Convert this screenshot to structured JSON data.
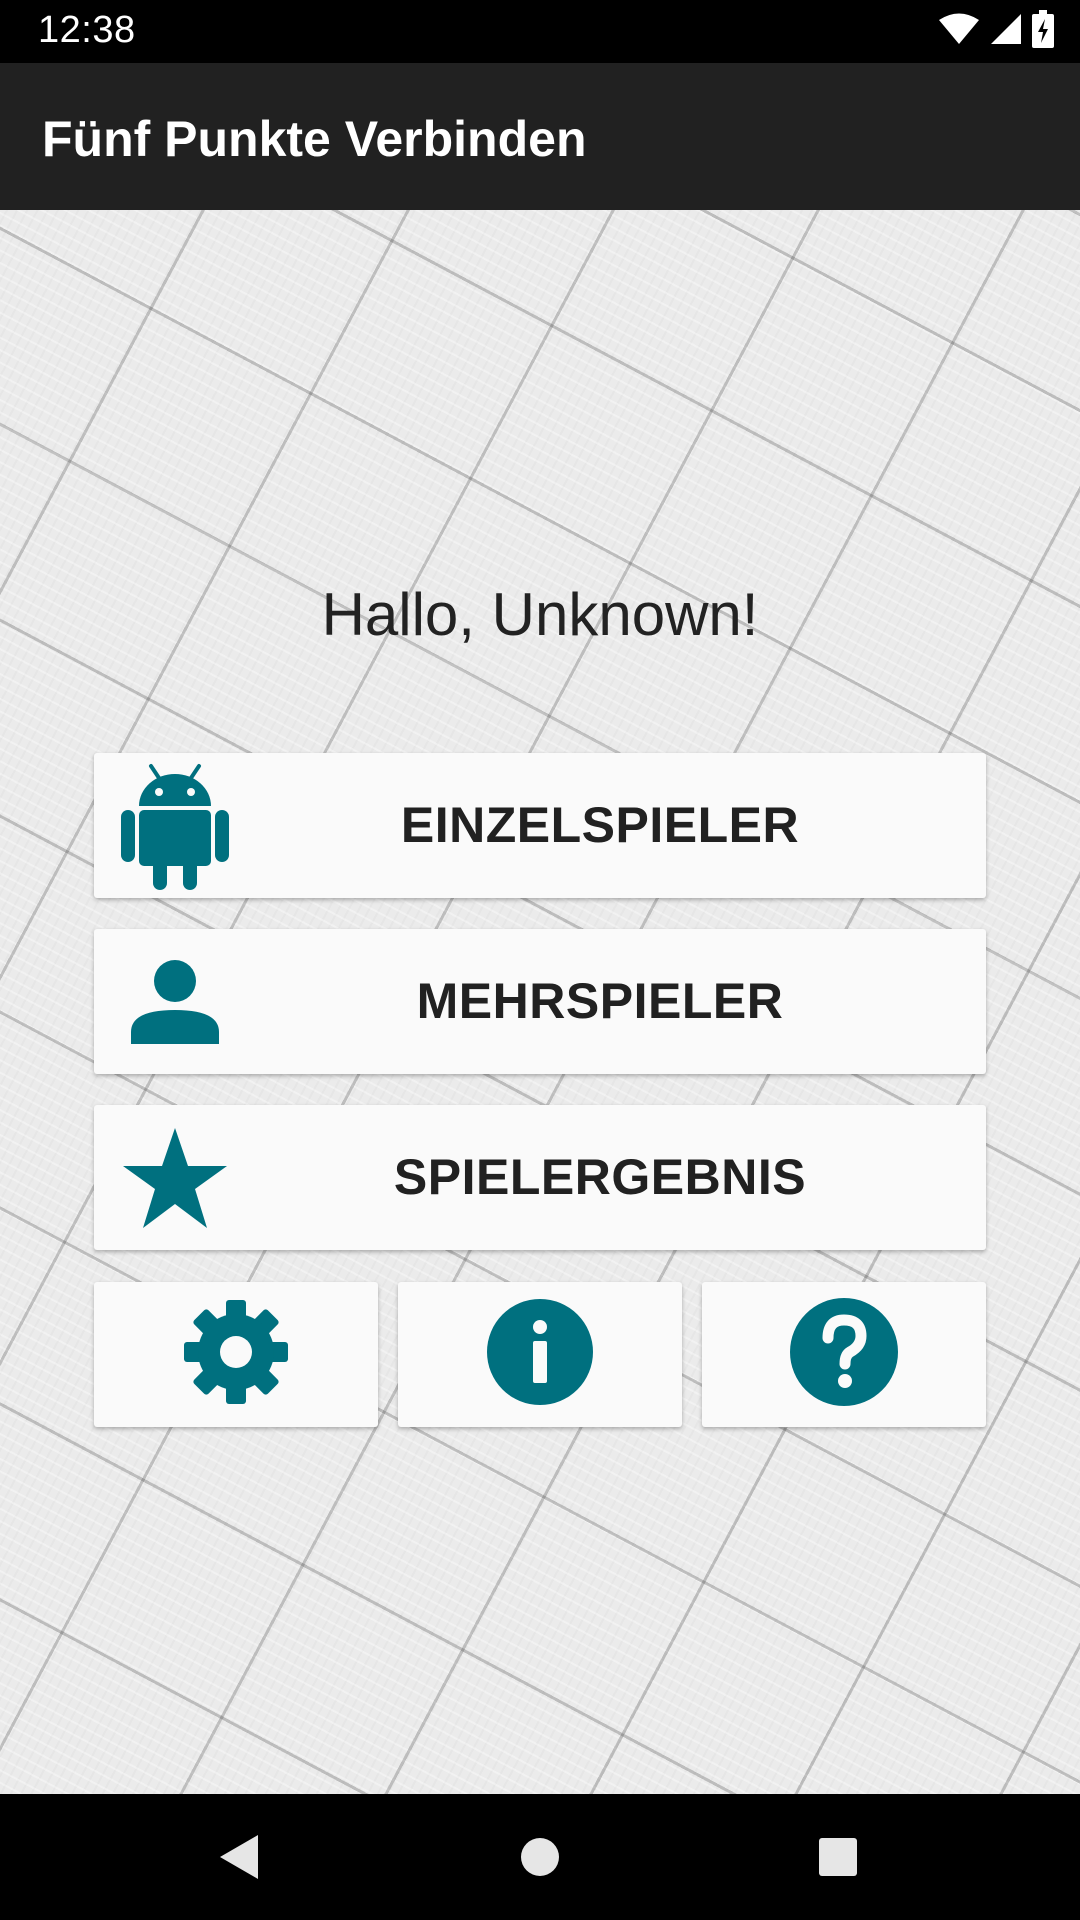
{
  "status_bar": {
    "time": "12:38",
    "icons": [
      "wifi-icon",
      "cell-signal-icon",
      "battery-charging-icon"
    ]
  },
  "app_bar": {
    "title": "Fünf Punkte Verbinden"
  },
  "main": {
    "greeting": "Hallo, Unknown!",
    "buttons": [
      {
        "label": "EINZELSPIELER",
        "icon": "android-icon"
      },
      {
        "label": "MEHRSPIELER",
        "icon": "person-icon"
      },
      {
        "label": "SPIELERGEBNIS",
        "icon": "star-icon"
      }
    ],
    "small_buttons": [
      {
        "icon": "settings-gear-icon"
      },
      {
        "icon": "info-icon"
      },
      {
        "icon": "help-icon"
      }
    ]
  },
  "navigation": {
    "buttons": [
      "back-icon",
      "home-icon",
      "recents-icon"
    ]
  },
  "colors": {
    "accent": "#00707f",
    "app_bar": "#212121",
    "button_bg": "#fafafa",
    "text": "#212121"
  }
}
